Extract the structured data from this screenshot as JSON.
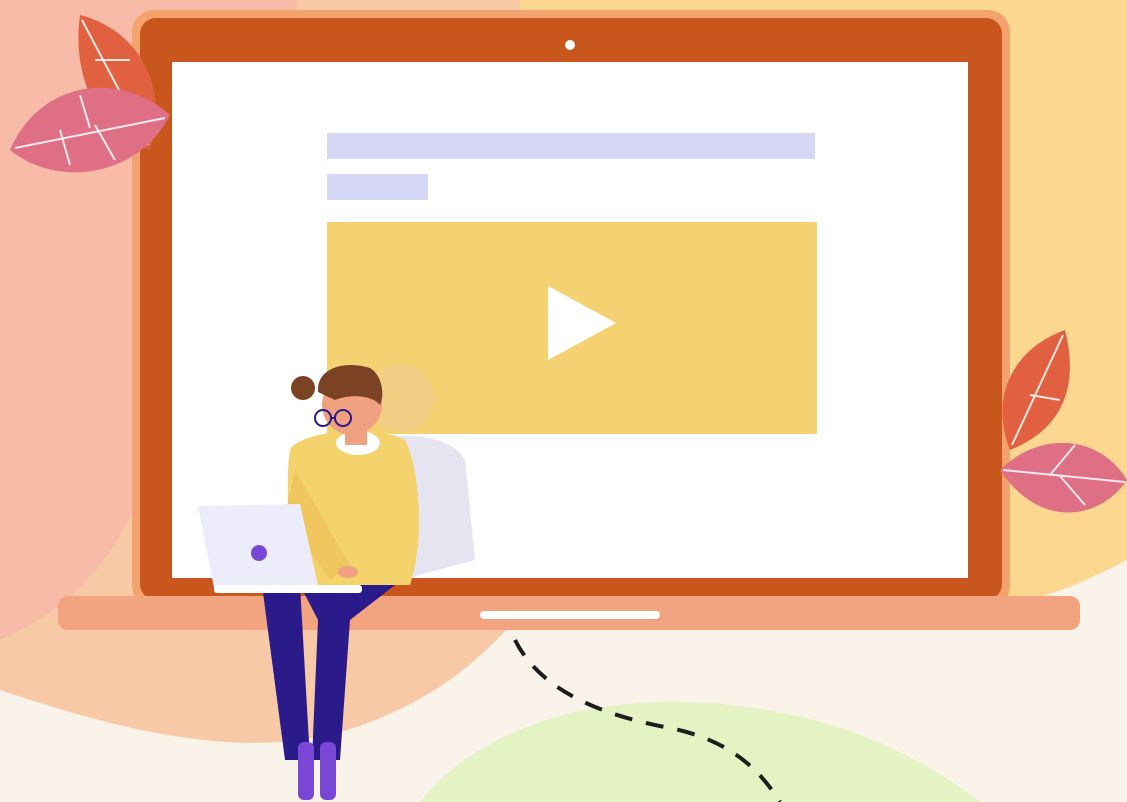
{
  "scene": {
    "description_free": true,
    "palette": {
      "background": "#faf3ea",
      "blob_peach": "#f8c9a7",
      "blob_pink": "#f6b3a8",
      "blob_yellow": "#fbd78f",
      "blob_green": "#e5f3c4",
      "laptop_frame": "#c9561c",
      "laptop_glow": "#f4a26e",
      "laptop_base": "#f2a481",
      "screen": "#ffffff",
      "placeholder_bar": "#d7d8f6",
      "video_block": "#f4d271",
      "play_icon": "#ffffff",
      "leaf_red": "#e0603f",
      "leaf_pink": "#df6f84",
      "sweater": "#f4d26c",
      "pants": "#2b1a8a",
      "hair": "#7b4224",
      "skin": "#f0a17f",
      "socks": "#7b47d6",
      "small_laptop": "#ececfb",
      "shadow_person": "#e7e4f2"
    },
    "icons": {
      "play": "play-icon",
      "webcam": "camera-icon",
      "small_laptop_logo": "logo-dot-icon"
    }
  }
}
